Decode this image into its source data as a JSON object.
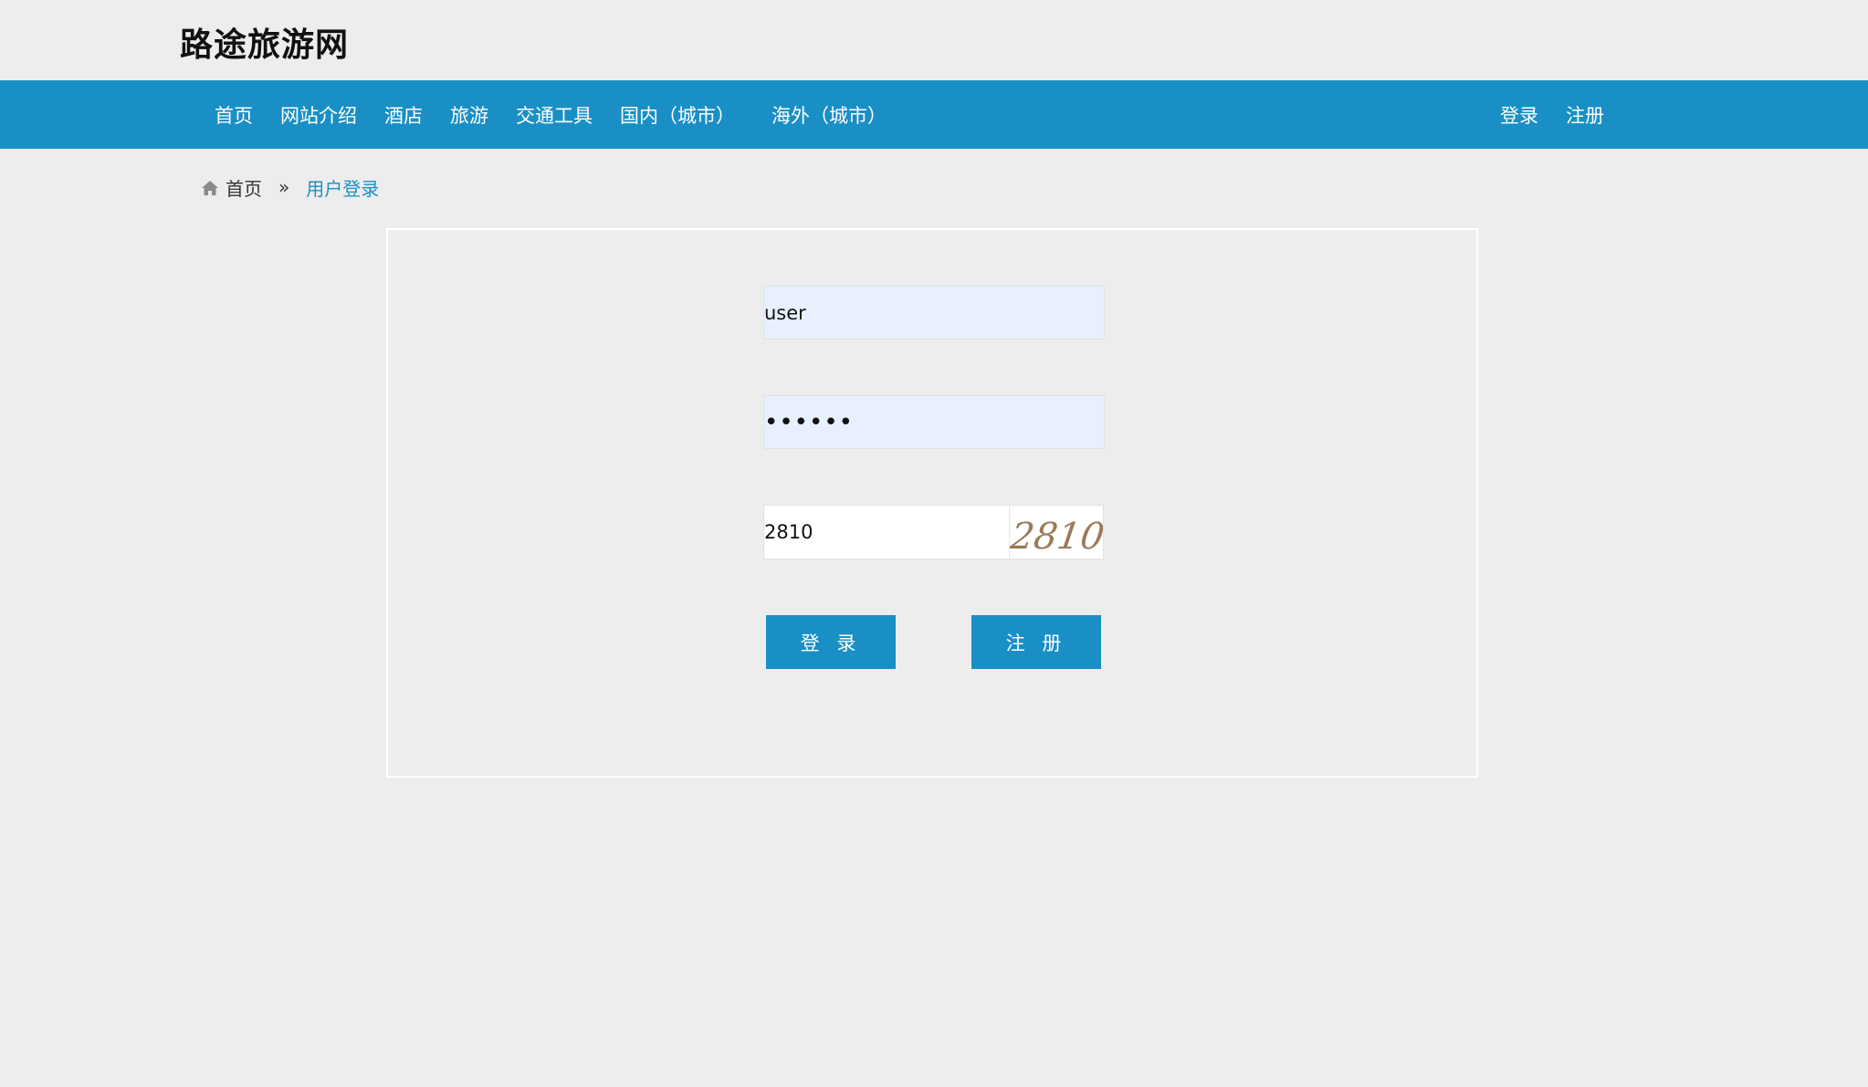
{
  "site": {
    "title": "路途旅游网"
  },
  "nav": {
    "items": [
      "首页",
      "网站介绍",
      "酒店",
      "旅游",
      "交通工具",
      "国内（城市）",
      "海外（城市）"
    ],
    "login_label": "登录",
    "register_label": "注册"
  },
  "breadcrumb": {
    "home": "首页",
    "separator": "»",
    "current": "用户登录"
  },
  "form": {
    "username_value": "user",
    "password_value": "••••••",
    "captcha_value": "2810",
    "captcha_image_text": "2810",
    "login_button": "登 录",
    "register_button": "注 册"
  },
  "colors": {
    "accent": "#1a8fc6",
    "background": "#ededed",
    "autofill": "#e8f0fe"
  }
}
